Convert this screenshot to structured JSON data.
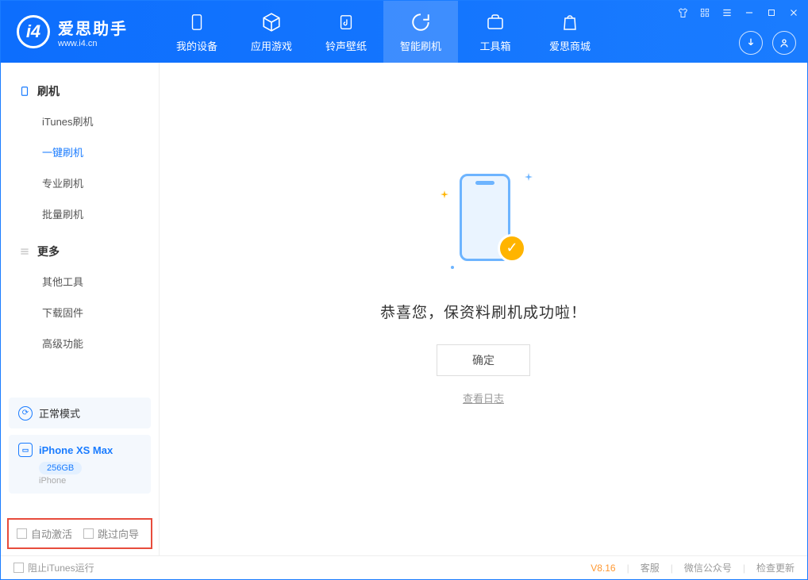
{
  "app": {
    "title": "爱思助手",
    "subtitle": "www.i4.cn"
  },
  "nav": {
    "items": [
      {
        "label": "我的设备"
      },
      {
        "label": "应用游戏"
      },
      {
        "label": "铃声壁纸"
      },
      {
        "label": "智能刷机"
      },
      {
        "label": "工具箱"
      },
      {
        "label": "爱思商城"
      }
    ],
    "activeIndex": 3
  },
  "sidebar": {
    "groups": [
      {
        "title": "刷机",
        "items": [
          "iTunes刷机",
          "一键刷机",
          "专业刷机",
          "批量刷机"
        ],
        "activeItem": "一键刷机"
      },
      {
        "title": "更多",
        "items": [
          "其他工具",
          "下载固件",
          "高级功能"
        ]
      }
    ]
  },
  "device": {
    "mode": "正常模式",
    "name": "iPhone XS Max",
    "capacity": "256GB",
    "type": "iPhone"
  },
  "options": {
    "autoActivate": "自动激活",
    "skipGuide": "跳过向导"
  },
  "main": {
    "success": "恭喜您，保资料刷机成功啦！",
    "ok": "确定",
    "viewLog": "查看日志"
  },
  "footer": {
    "blockItunes": "阻止iTunes运行",
    "version": "V8.16",
    "links": [
      "客服",
      "微信公众号",
      "检查更新"
    ]
  }
}
